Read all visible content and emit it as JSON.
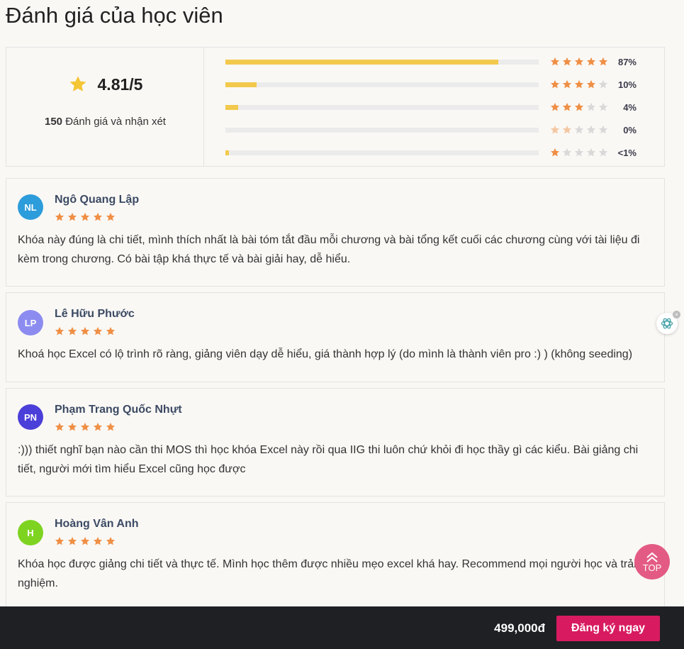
{
  "page": {
    "title": "Đánh giá của học viên"
  },
  "summary": {
    "score": "4.81/5",
    "count": "150",
    "count_label": "Đánh giá và nhận xét",
    "distribution": [
      {
        "stars": 5,
        "fraction": 0.87,
        "pct_label": "87%"
      },
      {
        "stars": 4,
        "fraction": 0.1,
        "pct_label": "10%"
      },
      {
        "stars": 3,
        "fraction": 0.04,
        "pct_label": "4%"
      },
      {
        "stars": 2,
        "fraction": 0.0,
        "pct_label": "0%"
      },
      {
        "stars": 1,
        "fraction": 0.01,
        "pct_label": "<1%"
      }
    ]
  },
  "reviews": [
    {
      "initials": "NL",
      "name": "Ngô Quang Lập",
      "rating": 5,
      "avatar_color": "#2d9cdb",
      "text": "Khóa này đúng là chi tiết, mình thích nhất là bài tóm tắt đầu mỗi chương và bài tổng kết cuối các chương cùng với tài liệu đi kèm trong chương. Có bài tập khá thực tế và bài giải hay, dễ hiểu."
    },
    {
      "initials": "LP",
      "name": "Lê Hữu Phước",
      "rating": 5,
      "avatar_color": "#8c8cf0",
      "text": "Khoá học Excel có lộ trình rõ ràng, giảng viên dạy dễ hiểu, giá thành hợp lý (do mình là thành viên pro :) ) (không seeding)"
    },
    {
      "initials": "PN",
      "name": "Phạm Trang Quốc Nhựt",
      "rating": 5,
      "avatar_color": "#4b3fd9",
      "text": ":))) thiết nghĩ bạn nào cần thi MOS thì học khóa Excel này rồi qua IIG thi luôn chứ khỏi đi học thầy gì các kiểu. Bài giảng chi tiết, người mới tìm hiểu Excel cũng học được"
    },
    {
      "initials": "H",
      "name": "Hoàng Vân Anh",
      "rating": 5,
      "avatar_color": "#7ed321",
      "text": "Khóa học được giảng chi tiết và thực tế. Mình học thêm được nhiều mẹo excel khá hay. Recommend mọi người học và trải nghiệm."
    }
  ],
  "widgets": {
    "top_label": "TOP",
    "ai_close": "×"
  },
  "footer": {
    "price": "499,000đ",
    "enroll_label": "Đăng ký ngay"
  },
  "colors": {
    "star_orange": "#ef8f45",
    "star_empty": "#d9d9d9",
    "bar_fill": "#f2c94c",
    "accent": "#d81b60"
  }
}
